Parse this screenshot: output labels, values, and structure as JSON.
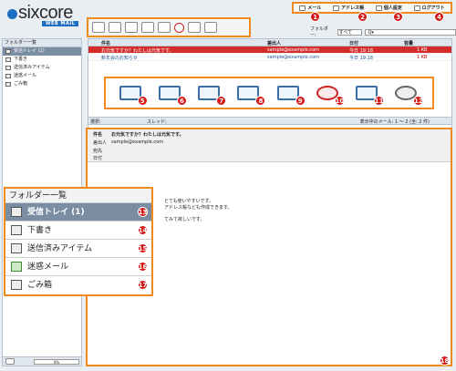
{
  "brand": {
    "name": "sixcore",
    "sub": "WEB MAIL"
  },
  "topnav": [
    {
      "label": "メール",
      "num": "1"
    },
    {
      "label": "アドレス帳",
      "num": "2"
    },
    {
      "label": "個人設定",
      "num": "3"
    },
    {
      "label": "ログアウト",
      "num": "4"
    }
  ],
  "filter": {
    "label": "フォルダー:",
    "value": "すべて",
    "search_placeholder": "Q▾"
  },
  "sidebar": {
    "title": "フォルダー一覧",
    "items": [
      {
        "label": "受信トレイ (1)"
      },
      {
        "label": "下書き"
      },
      {
        "label": "送信済みアイテム"
      },
      {
        "label": "迷惑メール"
      },
      {
        "label": "ごみ箱"
      }
    ],
    "quota": "0%"
  },
  "list": {
    "headers": [
      "件名",
      "差出人",
      "日付",
      "容量"
    ],
    "rows": [
      {
        "subject": "お元気ですか？わたしは元気です。",
        "from": "sample@example.com",
        "date": "今日 19:18",
        "size": "1 KB"
      },
      {
        "subject": "新年会のお知らせ",
        "from": "sample@example.com",
        "date": "今日 19:18",
        "size": "1 KB"
      }
    ],
    "pager_left": "選択:",
    "pager_thread": "スレッド:",
    "pager_right": "表示中のメール: 1 ～ 2 (全: 2 件)"
  },
  "preview": {
    "subject_label": "件名",
    "subject": "お元気ですか？わたしは元気です。",
    "from_label": "差出人",
    "from": "sample@example.com",
    "to_label": "宛先",
    "date_label": "日付",
    "body_lines": [
      "とても使いやすいです。",
      "アドレス帳なども作成できます。",
      "てみて欲しいです。"
    ]
  },
  "callouts": {
    "toolbar": [
      "5",
      "6",
      "7",
      "8",
      "9",
      "10",
      "11",
      "12"
    ],
    "folders": [
      "13",
      "14",
      "15",
      "16",
      "17"
    ],
    "preview": "18"
  },
  "colors": {
    "accent": "#f08a1c",
    "badge": "#d61515",
    "selected": "#7b8da3",
    "unread": "#d42b2b"
  }
}
